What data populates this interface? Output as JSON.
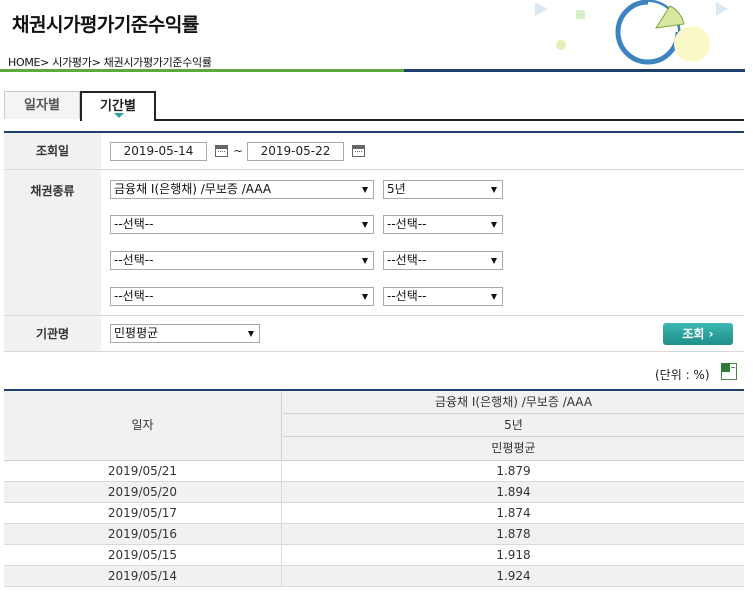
{
  "page": {
    "title": "채권시가평가기준수익률",
    "breadcrumb": "HOME> 시가평가> 채권시가평가기준수익률"
  },
  "tabs": [
    {
      "label": "일자별",
      "active": false
    },
    {
      "label": "기간별",
      "active": true
    }
  ],
  "form": {
    "date_label": "조회일",
    "start_date": "2019-05-14",
    "end_date": "2019-05-22",
    "tilde": "~",
    "bond_label": "채권종류",
    "bond_rows": [
      {
        "type": "금융채 I(은행채) /무보증 /AAA",
        "term": "5년"
      },
      {
        "type": "--선택--",
        "term": "--선택--"
      },
      {
        "type": "--선택--",
        "term": "--선택--"
      },
      {
        "type": "--선택--",
        "term": "--선택--"
      }
    ],
    "institution_label": "기관명",
    "institution_value": "민평평균",
    "search_button": "조회 ›"
  },
  "unit_text": "(단위 : %)",
  "table": {
    "date_header": "일자",
    "header_bond": "금융채 I(은행채) /무보증 /AAA",
    "header_term": "5년",
    "header_inst": "민평평균",
    "rows": [
      {
        "date": "2019/05/21",
        "value": "1.879"
      },
      {
        "date": "2019/05/20",
        "value": "1.894"
      },
      {
        "date": "2019/05/17",
        "value": "1.874"
      },
      {
        "date": "2019/05/16",
        "value": "1.878"
      },
      {
        "date": "2019/05/15",
        "value": "1.918"
      },
      {
        "date": "2019/05/14",
        "value": "1.924"
      }
    ]
  },
  "colors": {
    "accent_green": "#5aaa3c",
    "navy": "#1f3f6e",
    "teal_button": "#2aa3a9"
  }
}
